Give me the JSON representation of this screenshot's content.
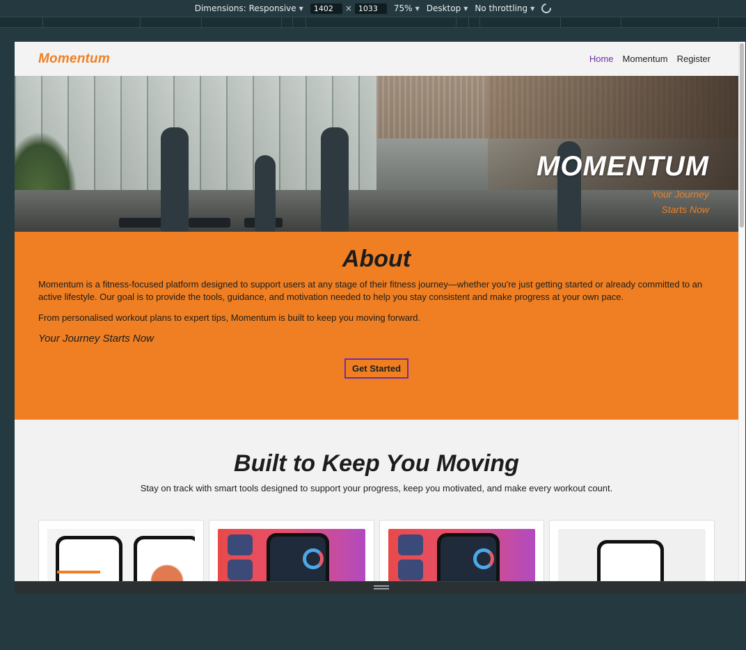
{
  "devtools": {
    "dimensions_label": "Dimensions: Responsive",
    "width": "1402",
    "height": "1033",
    "zoom": "75%",
    "device": "Desktop",
    "throttling": "No throttling",
    "x_sign": "×"
  },
  "navbar": {
    "brand": "Momentum",
    "links": [
      "Home",
      "Momentum",
      "Register"
    ]
  },
  "hero": {
    "title": "MOMENTUM",
    "subtitle_line1": "Your Journey",
    "subtitle_line2": "Starts Now"
  },
  "about": {
    "title": "About",
    "paragraph1": "Momentum is a fitness-focused platform designed to support users at any stage of their fitness journey—whether you're just getting started or already committed to an active lifestyle. Our goal is to provide the tools, guidance, and motivation needed to help you stay consistent and make progress at your own pace.",
    "paragraph2": "From personalised workout plans to expert tips, Momentum is built to keep you moving forward.",
    "tagline": "Your Journey Starts Now",
    "cta": "Get Started"
  },
  "features": {
    "title": "Built to Keep You Moving",
    "subtitle": "Stay on track with smart tools designed to support your progress, keep you motivated, and make every workout count.",
    "cards": [
      {
        "image": "goal-tracking-app"
      },
      {
        "image": "workout-routines-app"
      },
      {
        "image": "workout-routines-app"
      },
      {
        "image": "phone-app-screen"
      }
    ]
  },
  "colors": {
    "accent": "#ef7f22",
    "active_link": "#6b2fa8",
    "button_border": "#6b2fa8"
  }
}
